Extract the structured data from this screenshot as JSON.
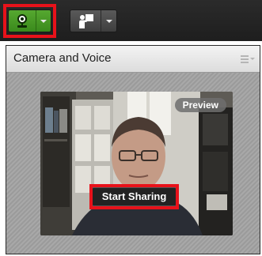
{
  "toolbar": {
    "camera_button": {
      "icon": "webcam-icon",
      "state": "active",
      "color": "#4fa62a"
    },
    "share_button": {
      "icon": "presenter-icon"
    }
  },
  "pod": {
    "title": "Camera and Voice",
    "menu_icon": "pod-menu-icon",
    "video": {
      "badge": "Preview",
      "action_label": "Start Sharing"
    }
  },
  "highlight_color": "#e8121a"
}
